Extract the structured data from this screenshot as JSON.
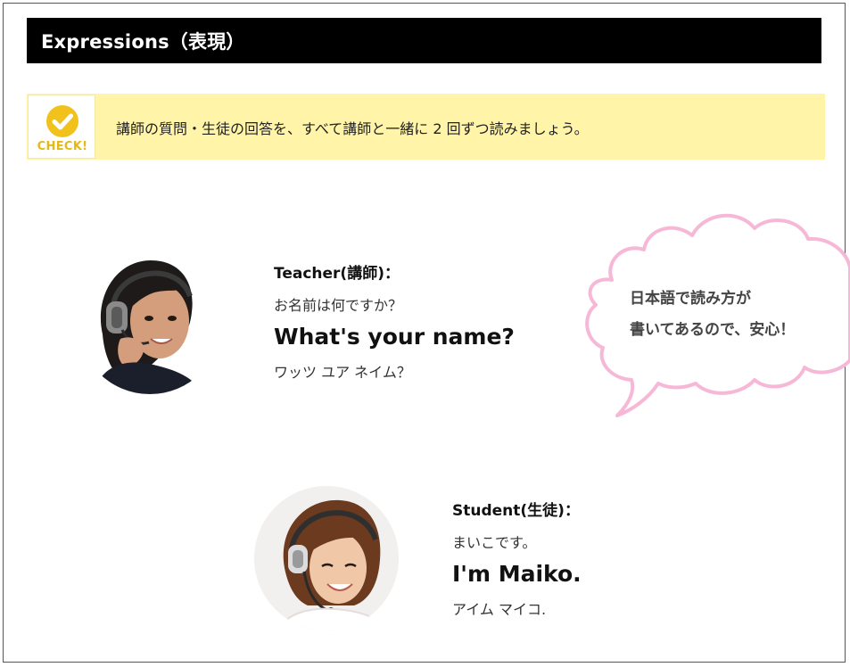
{
  "header": {
    "title": "Expressions（表現）"
  },
  "check": {
    "badge_label": "CHECK!",
    "message": "講師の質問・生徒の回答を、すべて講師と一緒に 2 回ずつ読みましょう。"
  },
  "teacher": {
    "label": "Teacher(講師)：",
    "japanese": "お名前は何ですか？",
    "english": "What's your name?",
    "katakana": "ワッツ ユア ネイム？"
  },
  "student": {
    "label": "Student(生徒)：",
    "japanese": "まいこです。",
    "english": "I'm Maiko.",
    "katakana": "アイム マイコ."
  },
  "bubble": {
    "line1": "日本語で読み方が",
    "line2": "書いてあるので、安心！"
  },
  "colors": {
    "header_bg": "#000000",
    "check_bg": "#fff4a8",
    "check_accent": "#f1c21b",
    "bubble_border": "#f6b8d6"
  }
}
